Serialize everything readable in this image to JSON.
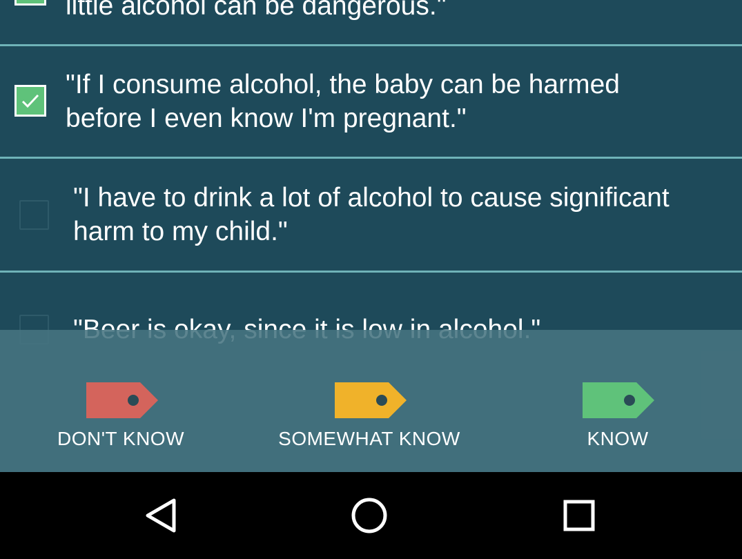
{
  "statements": [
    {
      "text": "little alcohol can be dangerous.\"",
      "checked": true
    },
    {
      "text": "\"If I consume alcohol, the baby can be harmed\nbefore I even know I'm pregnant.\"",
      "checked": true
    },
    {
      "text": "\"I have to drink a lot of alcohol to cause significant\nharm to my child.\"",
      "checked": false
    },
    {
      "text": "\"Beer is okay, since it is low in alcohol.\"",
      "checked": false
    }
  ],
  "rating": {
    "options": [
      {
        "label": "DON'T KNOW",
        "color": "#d4645c",
        "icon": "tag-icon-red"
      },
      {
        "label": "SOMEWHAT KNOW",
        "color": "#f0b22a",
        "icon": "tag-icon-yellow"
      },
      {
        "label": "KNOW",
        "color": "#5fc27a",
        "icon": "tag-icon-green"
      }
    ]
  },
  "navbar": {
    "back_icon": "back-triangle-icon",
    "home_icon": "home-circle-icon",
    "recents_icon": "recents-square-icon"
  },
  "colors": {
    "background": "#1e4a5a",
    "divider": "#6fb3b8",
    "check": "#5fc27a",
    "rating_bar": "#3f6d7a"
  }
}
